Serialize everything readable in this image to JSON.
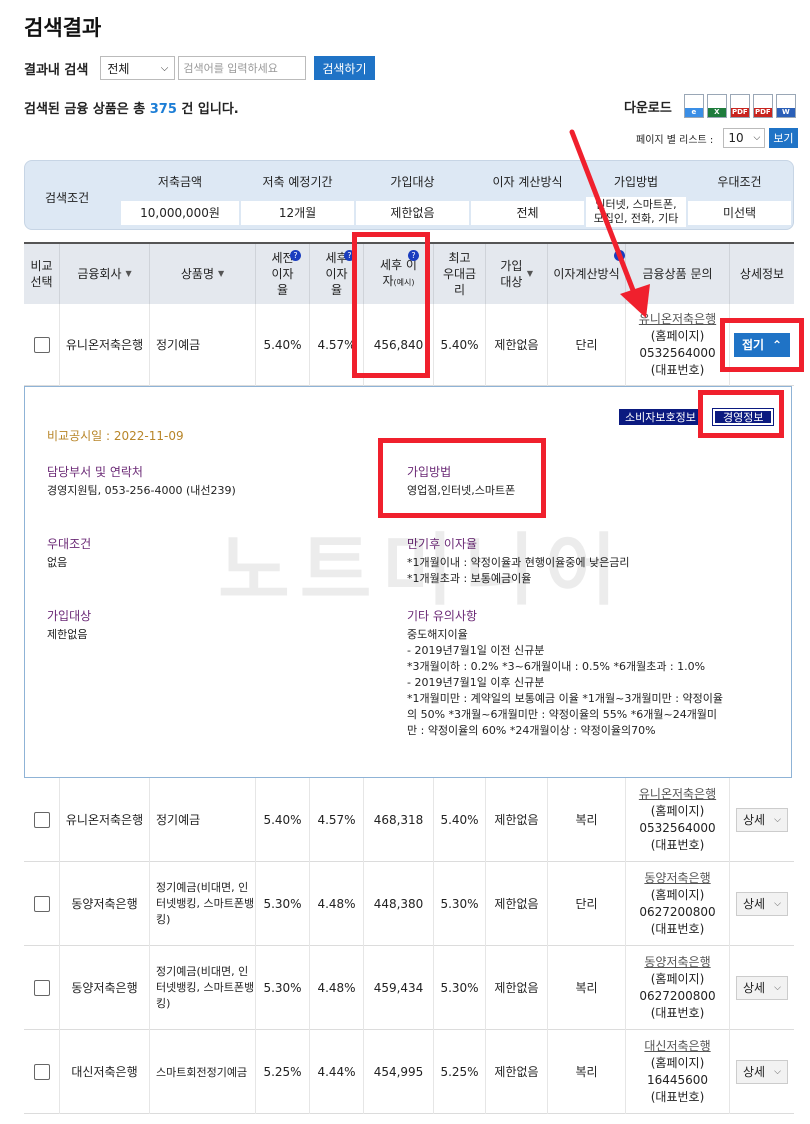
{
  "page": {
    "title": "검색결과"
  },
  "search": {
    "label": "결과내 검색",
    "select_value": "전체",
    "placeholder": "검색어를 입력하세요",
    "button": "검색하기"
  },
  "result": {
    "prefix": "검색된 금융 상품은 총",
    "count": "375",
    "suffix": "건 입니다."
  },
  "download": {
    "label": "다운로드",
    "icons": [
      "ie-icon",
      "excel-icon",
      "pdf-icon",
      "pdf-icon",
      "word-icon"
    ]
  },
  "perpage": {
    "label": "페이지 별 리스트 :",
    "value": "10",
    "button": "보기"
  },
  "conditions": {
    "title": "검색조건",
    "items": [
      {
        "label": "저축금액",
        "value": "10,000,000원"
      },
      {
        "label": "저축 예정기간",
        "value": "12개월"
      },
      {
        "label": "가입대상",
        "value": "제한없음"
      },
      {
        "label": "이자 계산방식",
        "value": "전체"
      },
      {
        "label": "가입방법",
        "value": "인터넷, 스마트폰, 모집인, 전화, 기타"
      },
      {
        "label": "우대조건",
        "value": "미선택"
      }
    ]
  },
  "table": {
    "headers": {
      "compare": "비교 선택",
      "company": "금융회사",
      "product": "상품명",
      "pre_rate": "세전 이자율",
      "post_rate": "세후 이자율",
      "post_interest": "세후 이자",
      "post_interest_note": "(예시)",
      "max_rate": "최고 우대금리",
      "target": "가입 대상",
      "calc": "이자계산방식",
      "contact": "금융상품 문의",
      "detail": "상세정보"
    },
    "rows": [
      {
        "company": "유니온저축은행",
        "product": "정기예금",
        "pre_rate": "5.40%",
        "post_rate": "4.57%",
        "post_interest": "456,840",
        "max_rate": "5.40%",
        "target": "제한없음",
        "calc": "단리",
        "contact_bank": "유니온저축은행",
        "contact_home": "(홈페이지)",
        "contact_phone": "0532564000",
        "contact_rep": "(대표번호)",
        "detail": "접기"
      },
      {
        "company": "유니온저축은행",
        "product": "정기예금",
        "pre_rate": "5.40%",
        "post_rate": "4.57%",
        "post_interest": "468,318",
        "max_rate": "5.40%",
        "target": "제한없음",
        "calc": "복리",
        "contact_bank": "유니온저축은행",
        "contact_home": "(홈페이지)",
        "contact_phone": "0532564000",
        "contact_rep": "(대표번호)",
        "detail": "상세"
      },
      {
        "company": "동양저축은행",
        "product": "정기예금(비대면, 인터넷뱅킹, 스마트폰뱅킹)",
        "pre_rate": "5.30%",
        "post_rate": "4.48%",
        "post_interest": "448,380",
        "max_rate": "5.30%",
        "target": "제한없음",
        "calc": "단리",
        "contact_bank": "동양저축은행",
        "contact_home": "(홈페이지)",
        "contact_phone": "0627200800",
        "contact_rep": "(대표번호)",
        "detail": "상세"
      },
      {
        "company": "동양저축은행",
        "product": "정기예금(비대면, 인터넷뱅킹, 스마트폰뱅킹)",
        "pre_rate": "5.30%",
        "post_rate": "4.48%",
        "post_interest": "459,434",
        "max_rate": "5.30%",
        "target": "제한없음",
        "calc": "복리",
        "contact_bank": "동양저축은행",
        "contact_home": "(홈페이지)",
        "contact_phone": "0627200800",
        "contact_rep": "(대표번호)",
        "detail": "상세"
      },
      {
        "company": "대신저축은행",
        "product": "스마트회전정기예금",
        "pre_rate": "5.25%",
        "post_rate": "4.44%",
        "post_interest": "454,995",
        "max_rate": "5.25%",
        "target": "제한없음",
        "calc": "복리",
        "contact_bank": "대신저축은행",
        "contact_home": "(홈페이지)",
        "contact_phone": "16445600",
        "contact_rep": "(대표번호)",
        "detail": "상세"
      }
    ]
  },
  "detail_panel": {
    "consumer_btn": "소비자보호정보",
    "mgmt_btn": "경영정보",
    "pub_date": "비교공시일 : 2022-11-09",
    "dept_h": "담당부서 및 연락처",
    "dept_t": "경영지원팀, 053-256-4000 (내선239)",
    "method_h": "가입방법",
    "method_t": "영업점,인터넷,스마트폰",
    "pref_h": "우대조건",
    "pref_t": "없음",
    "maturity_h": "만기후 이자율",
    "maturity_lines": [
      "*1개월이내 : 약정이율과 현행이율중에 낮은금리",
      "*1개월초과 : 보통예금이율"
    ],
    "target_h": "가입대상",
    "target_t": "제한없음",
    "etc_h": "기타 유의사항",
    "etc_lines": [
      "중도해지이율",
      "- 2019년7월1일 이전 신규분",
      "*3개월이하 : 0.2% *3~6개월이내 : 0.5% *6개월초과 : 1.0%",
      "- 2019년7월1일 이후 신규분",
      "*1개월미만 : 계약일의 보통예금 이율 *1개월~3개월미만 : 약정이율",
      "의 50% *3개월~6개월미만 : 약정이율의 55% *6개월~24개월미",
      "만 : 약정이율의 60% *24개월이상 : 약정이율의70%"
    ]
  },
  "watermark": "노트미니어",
  "colors": {
    "accent": "#1f73c6",
    "highlight": "#f0202d",
    "navy": "#0b1a80",
    "section": "#6b2a76"
  }
}
